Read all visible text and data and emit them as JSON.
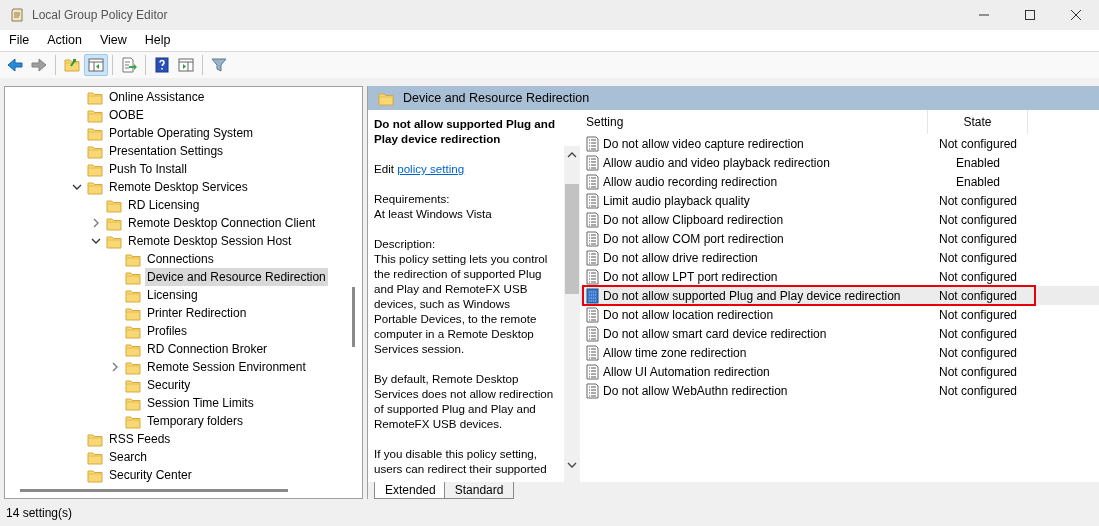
{
  "window": {
    "title": "Local Group Policy Editor"
  },
  "menu": [
    "File",
    "Action",
    "View",
    "Help"
  ],
  "toolbar": [
    [
      {
        "kind": "back",
        "pressed": false,
        "disabled": false
      },
      {
        "kind": "forward",
        "pressed": false,
        "disabled": true
      }
    ],
    [
      {
        "kind": "up",
        "pressed": false,
        "disabled": false
      },
      {
        "kind": "tree",
        "pressed": true,
        "disabled": false
      }
    ],
    [
      {
        "kind": "export",
        "pressed": false,
        "disabled": false
      }
    ],
    [
      {
        "kind": "help",
        "pressed": false,
        "disabled": false
      },
      {
        "kind": "pane",
        "pressed": false,
        "disabled": false
      }
    ],
    [
      {
        "kind": "filter",
        "pressed": false,
        "disabled": false
      }
    ]
  ],
  "tree": [
    {
      "label": "Online Assistance",
      "selected": false
    },
    {
      "label": "OOBE",
      "selected": false
    },
    {
      "label": "Portable Operating System",
      "selected": false
    },
    {
      "label": "Presentation Settings",
      "selected": false
    },
    {
      "label": "Push To Install",
      "selected": false
    },
    {
      "label": "Remote Desktop Services",
      "selected": false,
      "expanded": true,
      "children": [
        {
          "label": "RD Licensing",
          "selected": false
        },
        {
          "label": "Remote Desktop Connection Client",
          "selected": false,
          "expanded": false
        },
        {
          "label": "Remote Desktop Session Host",
          "selected": false,
          "expanded": true,
          "children": [
            {
              "label": "Connections",
              "selected": false
            },
            {
              "label": "Device and Resource Redirection",
              "selected": true
            },
            {
              "label": "Licensing",
              "selected": false
            },
            {
              "label": "Printer Redirection",
              "selected": false
            },
            {
              "label": "Profiles",
              "selected": false
            },
            {
              "label": "RD Connection Broker",
              "selected": false
            },
            {
              "label": "Remote Session Environment",
              "selected": false,
              "expanded": false
            },
            {
              "label": "Security",
              "selected": false
            },
            {
              "label": "Session Time Limits",
              "selected": false
            },
            {
              "label": "Temporary folders",
              "selected": false
            }
          ]
        }
      ]
    },
    {
      "label": "RSS Feeds",
      "selected": false
    },
    {
      "label": "Search",
      "selected": false
    },
    {
      "label": "Security Center",
      "selected": false
    }
  ],
  "header": {
    "title": "Device and Resource Redirection"
  },
  "details": {
    "title": "Do not allow supported Plug and Play device redirection",
    "edit_prefix": "Edit",
    "edit_link": "policy setting",
    "paragraphs": [
      [
        "Requirements:",
        "At least Windows Vista"
      ],
      [
        "Description:",
        "This policy setting lets you control",
        "the redirection of supported Plug",
        "and Play and RemoteFX USB",
        "devices, such as Windows",
        "Portable Devices, to the remote",
        "computer in a Remote Desktop",
        "Services session."
      ],
      [
        "By default, Remote Desktop",
        "Services does not allow redirection",
        "of supported Plug and Play and",
        "RemoteFX USB devices."
      ],
      [
        "If you disable this policy setting,",
        "users can redirect their supported"
      ]
    ]
  },
  "table": {
    "columns": [
      "Setting",
      "State"
    ],
    "rows": [
      {
        "setting": "Do not allow video capture redirection",
        "state": "Not configured",
        "selected": false,
        "highlighted": false
      },
      {
        "setting": "Allow audio and video playback redirection",
        "state": "Enabled",
        "selected": false,
        "highlighted": false
      },
      {
        "setting": "Allow audio recording redirection",
        "state": "Enabled",
        "selected": false,
        "highlighted": false
      },
      {
        "setting": "Limit audio playback quality",
        "state": "Not configured",
        "selected": false,
        "highlighted": false
      },
      {
        "setting": "Do not allow Clipboard redirection",
        "state": "Not configured",
        "selected": false,
        "highlighted": false
      },
      {
        "setting": "Do not allow COM port redirection",
        "state": "Not configured",
        "selected": false,
        "highlighted": false
      },
      {
        "setting": "Do not allow drive redirection",
        "state": "Not configured",
        "selected": false,
        "highlighted": false
      },
      {
        "setting": "Do not allow LPT port redirection",
        "state": "Not configured",
        "selected": false,
        "highlighted": false
      },
      {
        "setting": "Do not allow supported Plug and Play device redirection",
        "state": "Not configured",
        "selected": true,
        "highlighted": true
      },
      {
        "setting": "Do not allow location redirection",
        "state": "Not configured",
        "selected": false,
        "highlighted": false
      },
      {
        "setting": "Do not allow smart card device redirection",
        "state": "Not configured",
        "selected": false,
        "highlighted": false
      },
      {
        "setting": "Allow time zone redirection",
        "state": "Not configured",
        "selected": false,
        "highlighted": false
      },
      {
        "setting": "Allow UI Automation redirection",
        "state": "Not configured",
        "selected": false,
        "highlighted": false
      },
      {
        "setting": "Do not allow WebAuthn redirection",
        "state": "Not configured",
        "selected": false,
        "highlighted": false
      }
    ]
  },
  "tabs": [
    {
      "label": "Extended",
      "selected": true
    },
    {
      "label": "Standard",
      "selected": false
    }
  ],
  "status_bar": "14 setting(s)"
}
